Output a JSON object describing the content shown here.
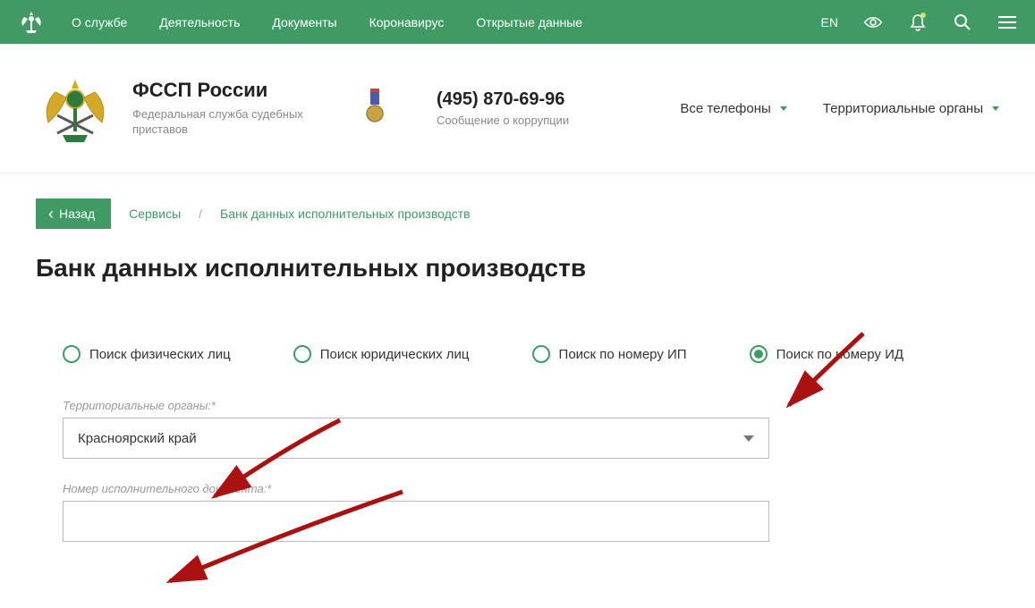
{
  "topnav": {
    "items": [
      "О службе",
      "Деятельность",
      "Документы",
      "Коронавирус",
      "Открытые данные"
    ],
    "lang": "EN"
  },
  "brand": {
    "title": "ФССП России",
    "subtitle": "Федеральная служба судебных приставов",
    "phone": "(495) 870-69-96",
    "phone_sub": "Сообщение о коррупции",
    "link_phones": "Все телефоны",
    "link_regions": "Территориальные органы"
  },
  "crumbs": {
    "back": "Назад",
    "services": "Сервисы",
    "current": "Банк данных исполнительных производств"
  },
  "page": {
    "title": "Банк данных исполнительных производств"
  },
  "form": {
    "radios": [
      {
        "label": "Поиск физических лиц",
        "checked": false
      },
      {
        "label": "Поиск юридических лиц",
        "checked": false
      },
      {
        "label": "Поиск по номеру ИП",
        "checked": false
      },
      {
        "label": "Поиск по номеру ИД",
        "checked": true
      }
    ],
    "region_label": "Территориальные органы:*",
    "region_value": "Красноярский край",
    "docnum_label": "Номер исполнительного документа:*",
    "docnum_value": ""
  }
}
